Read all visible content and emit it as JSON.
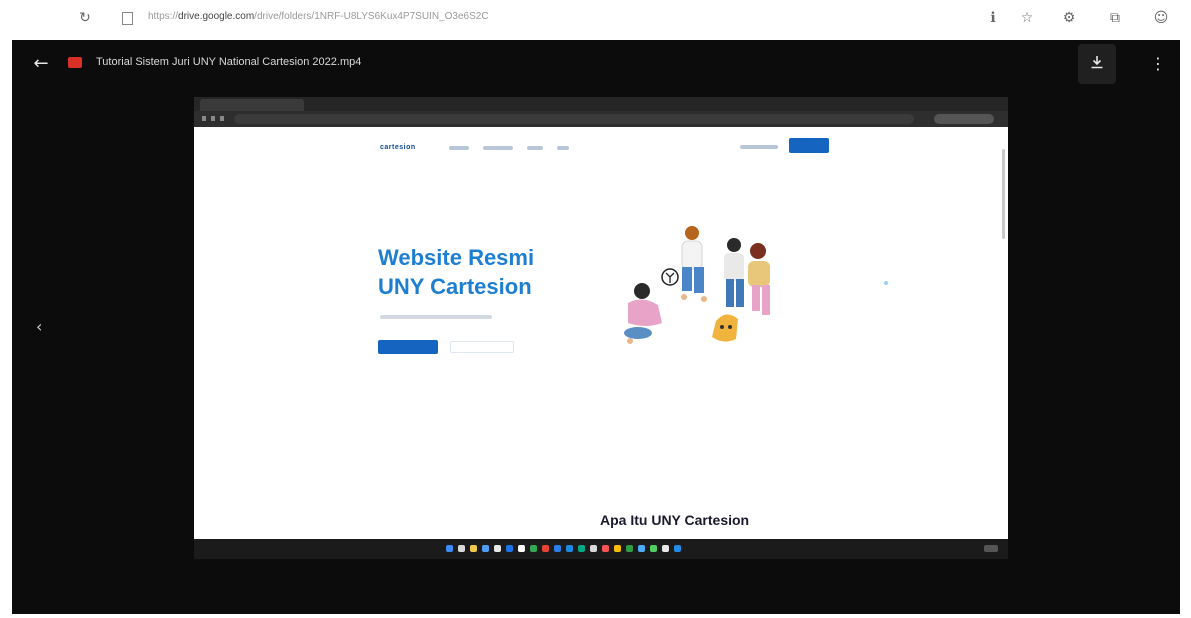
{
  "browser": {
    "url_prefix": "https://",
    "url_host": "drive.google.com",
    "url_path": "/drive/folders/1NRF-U8LYS6Kux4P7SUIN_O3e6S2C",
    "icons": [
      "refresh-icon",
      "page-icon",
      "reader-icon",
      "bookmark-icon",
      "extensions-icon",
      "collections-icon",
      "profile-icon"
    ]
  },
  "viewer": {
    "file_title": "Tutorial Sistem Juri UNY National Cartesion 2022.mp4",
    "back_icon": "arrow-left-icon",
    "download_icon": "download-icon",
    "more_icon": "more-vert-icon",
    "prev_icon": "chevron-left-icon"
  },
  "video": {
    "site_logo": "cartesion",
    "hero_title_line1": "Website Resmi",
    "hero_title_line2": "UNY Cartesion",
    "section_title": "Apa Itu UNY Cartesion",
    "accent_color": "#1565c0",
    "title_color": "#1e7fd1"
  }
}
